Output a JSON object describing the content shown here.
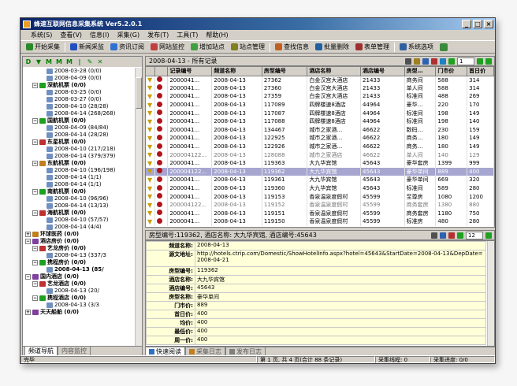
{
  "window": {
    "title": "蜂速互联网信息采集系统 Ver5.2.0.1",
    "btn_min": "_",
    "btn_max": "□",
    "btn_close": "×"
  },
  "menu": [
    "系统(S)",
    "查看(V)",
    "信息(I)",
    "采集(G)",
    "发布(T)",
    "工具(T)",
    "帮助(H)"
  ],
  "toolbar": [
    {
      "label": "开始采集",
      "icon": "play-icon",
      "color": "#2a8a2a"
    },
    {
      "label": "新闻采监",
      "icon": "news-icon",
      "color": "#2050c0"
    },
    {
      "label": "资讯订阅",
      "icon": "subscribe-icon",
      "color": "#3070d0"
    },
    {
      "label": "网站监控",
      "icon": "monitor-icon",
      "color": "#c04040"
    },
    {
      "label": "增加站点",
      "icon": "add-site-icon",
      "color": "#40a040"
    },
    {
      "label": "站点管理",
      "icon": "site-manage-icon",
      "color": "#808020"
    },
    {
      "label": "查找信息",
      "icon": "find-icon",
      "color": "#c06020"
    },
    {
      "label": "批量删除",
      "icon": "batch-delete-icon",
      "color": "#2060a0"
    },
    {
      "label": "表单管理",
      "icon": "form-icon",
      "color": "#a03030"
    },
    {
      "label": "系统选项",
      "icon": "options-icon",
      "color": "#3060a0"
    }
  ],
  "left_toolbar": [
    "D",
    "▼",
    "M",
    "M",
    "M",
    "|",
    "✎",
    "✕"
  ],
  "tree": [
    {
      "indent": 2,
      "text": "2008-03-28 (0/0)",
      "pm": "",
      "cls": ""
    },
    {
      "indent": 2,
      "text": "2008-04-09 (0/0)",
      "pm": "",
      "cls": ""
    },
    {
      "indent": 1,
      "text": "深航机票 (0/0)",
      "pm": "−",
      "cls": "b"
    },
    {
      "indent": 2,
      "text": "2008-03-25 (0/0)",
      "pm": "",
      "cls": ""
    },
    {
      "indent": 2,
      "text": "2008-03-27 (0/0)",
      "pm": "",
      "cls": ""
    },
    {
      "indent": 2,
      "text": "2008-04-10 (28/28)",
      "pm": "",
      "cls": ""
    },
    {
      "indent": 2,
      "text": "2008-04-14 (268/268)",
      "pm": "",
      "cls": ""
    },
    {
      "indent": 1,
      "text": "国航机票 (0/0)",
      "pm": "−",
      "cls": "b"
    },
    {
      "indent": 2,
      "text": "2008-04-09 (84/84)",
      "pm": "",
      "cls": ""
    },
    {
      "indent": 2,
      "text": "2008-04-14 (28/28)",
      "pm": "",
      "cls": ""
    },
    {
      "indent": 1,
      "text": "东星机票 (0/0)",
      "pm": "−",
      "cls": "b"
    },
    {
      "indent": 2,
      "text": "2008-04-10 (217/218)",
      "pm": "",
      "cls": ""
    },
    {
      "indent": 2,
      "text": "2008-04-14 (379/379)",
      "pm": "",
      "cls": ""
    },
    {
      "indent": 1,
      "text": "东航机票 (0/0)",
      "pm": "−",
      "cls": "b"
    },
    {
      "indent": 2,
      "text": "2008-04-10 (196/198)",
      "pm": "",
      "cls": ""
    },
    {
      "indent": 2,
      "text": "2008-04-14 (1/1)",
      "pm": "",
      "cls": ""
    },
    {
      "indent": 2,
      "text": "2008-04-14 (1/1)",
      "pm": "",
      "cls": ""
    },
    {
      "indent": 1,
      "text": "南航机票 (0/0)",
      "pm": "−",
      "cls": "b"
    },
    {
      "indent": 2,
      "text": "2008-04-10 (96/96)",
      "pm": "",
      "cls": ""
    },
    {
      "indent": 2,
      "text": "2008-04-14 (13/13)",
      "pm": "",
      "cls": ""
    },
    {
      "indent": 1,
      "text": "海航机票 (0/0)",
      "pm": "−",
      "cls": "b"
    },
    {
      "indent": 2,
      "text": "2008-04-10 (57/57)",
      "pm": "",
      "cls": ""
    },
    {
      "indent": 2,
      "text": "2008-04-14 (4/4)",
      "pm": "",
      "cls": ""
    },
    {
      "indent": 0,
      "text": "环球医药 (0/0)",
      "pm": "+",
      "cls": "b"
    },
    {
      "indent": 0,
      "text": "酒店房价 (0/0)",
      "pm": "−",
      "cls": "b"
    },
    {
      "indent": 1,
      "text": "艺龙房价 (0/0)",
      "pm": "−",
      "cls": "b"
    },
    {
      "indent": 2,
      "text": "2008-04-13 (337/3",
      "pm": "",
      "cls": ""
    },
    {
      "indent": 1,
      "text": "携程房价 (0/0)",
      "pm": "−",
      "cls": "b"
    },
    {
      "indent": 2,
      "text": "2008-04-13 (85/",
      "pm": "",
      "cls": "b"
    },
    {
      "indent": 0,
      "text": "国内酒店 (0/0)",
      "pm": "−",
      "cls": "b"
    },
    {
      "indent": 1,
      "text": "艺龙酒店 (0/0)",
      "pm": "−",
      "cls": "b"
    },
    {
      "indent": 2,
      "text": "2008-04-13 (20/",
      "pm": "",
      "cls": ""
    },
    {
      "indent": 1,
      "text": "携程酒店 (0/0)",
      "pm": "−",
      "cls": "b"
    },
    {
      "indent": 2,
      "text": "2008-04-13 (3/3",
      "pm": "",
      "cls": ""
    },
    {
      "indent": 0,
      "text": "天天船舶 (0/0)",
      "pm": "+",
      "cls": "b"
    }
  ],
  "left_tabs": [
    "频道导航",
    "内容监控"
  ],
  "list_header": {
    "title": "2008-04-13 - 所有记录",
    "page_value": "1"
  },
  "columns": [
    "",
    "",
    "记录编号",
    "频道名称",
    "房型编号",
    "酒店名称",
    "酒店编号",
    "房型…",
    "门市价",
    "首日价"
  ],
  "rows": [
    {
      "id": "2000041...",
      "ch": "2008-04-13",
      "room": "27362",
      "hotel": "白金汉宫大酒店",
      "hid": "21433",
      "type": "商务间",
      "price": "588",
      "first": "314",
      "cls": ""
    },
    {
      "id": "2000041...",
      "ch": "2008-04-13",
      "room": "27360",
      "hotel": "白金汉宫大酒店",
      "hid": "21433",
      "type": "单人间",
      "price": "588",
      "first": "314",
      "cls": ""
    },
    {
      "id": "2000041...",
      "ch": "2008-04-13",
      "room": "27359",
      "hotel": "白金汉宫大酒店",
      "hid": "21433",
      "type": "标准间",
      "price": "488",
      "first": "269",
      "cls": ""
    },
    {
      "id": "2000041...",
      "ch": "2008-04-13",
      "room": "117089",
      "hotel": "四牌楼速8酒店",
      "hid": "44964",
      "type": "豪华…",
      "price": "220",
      "first": "170",
      "cls": ""
    },
    {
      "id": "2000041...",
      "ch": "2008-04-13",
      "room": "117087",
      "hotel": "四牌楼速8酒店",
      "hid": "44964",
      "type": "标准间",
      "price": "198",
      "first": "149",
      "cls": ""
    },
    {
      "id": "2000041...",
      "ch": "2008-04-13",
      "room": "117088",
      "hotel": "四牌楼速8酒店",
      "hid": "44964",
      "type": "标准间",
      "price": "198",
      "first": "140",
      "cls": ""
    },
    {
      "id": "2000041...",
      "ch": "2008-04-13",
      "room": "134467",
      "hotel": "城市之家酒…",
      "hid": "46622",
      "type": "数码…",
      "price": "230",
      "first": "159",
      "cls": ""
    },
    {
      "id": "2000041...",
      "ch": "2008-04-13",
      "room": "122925",
      "hotel": "城市之家酒…",
      "hid": "46622",
      "type": "商务…",
      "price": "180",
      "first": "149",
      "cls": ""
    },
    {
      "id": "2000041...",
      "ch": "2008-04-13",
      "room": "122926",
      "hotel": "城市之家酒…",
      "hid": "46622",
      "type": "商务…",
      "price": "180",
      "first": "149",
      "cls": ""
    },
    {
      "id": "200004122...",
      "ch": "2008-04-13",
      "room": "128088",
      "hotel": "城市之家酒店",
      "hid": "46622",
      "type": "单人间",
      "price": "140",
      "first": "129",
      "cls": "gray"
    },
    {
      "id": "2000041...",
      "ch": "2008-04-13",
      "room": "119363",
      "hotel": "大九华宾馆",
      "hid": "45643",
      "type": "豪华套房",
      "price": "1399",
      "first": "999",
      "cls": ""
    },
    {
      "id": "200004122...",
      "ch": "2008-04-13",
      "room": "119362",
      "hotel": "大九华宾馆",
      "hid": "45643",
      "type": "豪华单间",
      "price": "889",
      "first": "400",
      "cls": "sel"
    },
    {
      "id": "2000041...",
      "ch": "2008-04-13",
      "room": "119361",
      "hotel": "大九华宾馆",
      "hid": "45643",
      "type": "豪华单间",
      "price": "669",
      "first": "320",
      "cls": ""
    },
    {
      "id": "2000041...",
      "ch": "2008-04-13",
      "room": "119360",
      "hotel": "大九华宾馆",
      "hid": "45643",
      "type": "标准间",
      "price": "589",
      "first": "280",
      "cls": ""
    },
    {
      "id": "2000041...",
      "ch": "2008-04-13",
      "room": "119153",
      "hotel": "香泉温泉度假村",
      "hid": "45599",
      "type": "至尊房",
      "price": "1080",
      "first": "1200",
      "cls": ""
    },
    {
      "id": "200004122...",
      "ch": "2008-04-13",
      "room": "119152",
      "hotel": "香泉温泉度假村",
      "hid": "45599",
      "type": "商务套房",
      "price": "1380",
      "first": "880",
      "cls": "gray"
    },
    {
      "id": "2000041...",
      "ch": "2008-04-13",
      "room": "119151",
      "hotel": "香泉温泉度假村",
      "hid": "45599",
      "type": "商务套房",
      "price": "1180",
      "first": "750",
      "cls": ""
    },
    {
      "id": "2000041...",
      "ch": "2008-04-13",
      "room": "119150",
      "hotel": "香泉温泉度假村",
      "hid": "45599",
      "type": "标准房",
      "price": "480",
      "first": "280",
      "cls": ""
    }
  ],
  "detail_header": {
    "title": "房型编号:119362, 酒店名称: 大九华宾馆, 酒店编号:45643",
    "page_value": "12"
  },
  "detail": [
    {
      "k": "频道名称:",
      "v": "2008-04-13"
    },
    {
      "k": "源文地址:",
      "v": "http://hotels.ctrip.com/Domestic/ShowHotelInfo.aspx?hotel=45643&StartDate=2008-04-13&DepDate=2008-04-21"
    },
    {
      "k": "房型编号:",
      "v": "119362"
    },
    {
      "k": "酒店名称:",
      "v": "大九华宾馆"
    },
    {
      "k": "酒店编号:",
      "v": "45643"
    },
    {
      "k": "房型名称:",
      "v": "豪华单间"
    },
    {
      "k": "门市价:",
      "v": "889"
    },
    {
      "k": "首日价:",
      "v": "400"
    },
    {
      "k": "均价:",
      "v": "400"
    },
    {
      "k": "最低价:",
      "v": "400"
    },
    {
      "k": "周一价:",
      "v": "400"
    }
  ],
  "right_tabs": [
    "快速阅读",
    "采集日志",
    "发布日志"
  ],
  "status": {
    "ready": "完毕",
    "pages": "第 1 页, 共 4 页(合计 88 条记录)",
    "thread": "采集线程: 0",
    "progress": "采集进度: 0/0"
  }
}
